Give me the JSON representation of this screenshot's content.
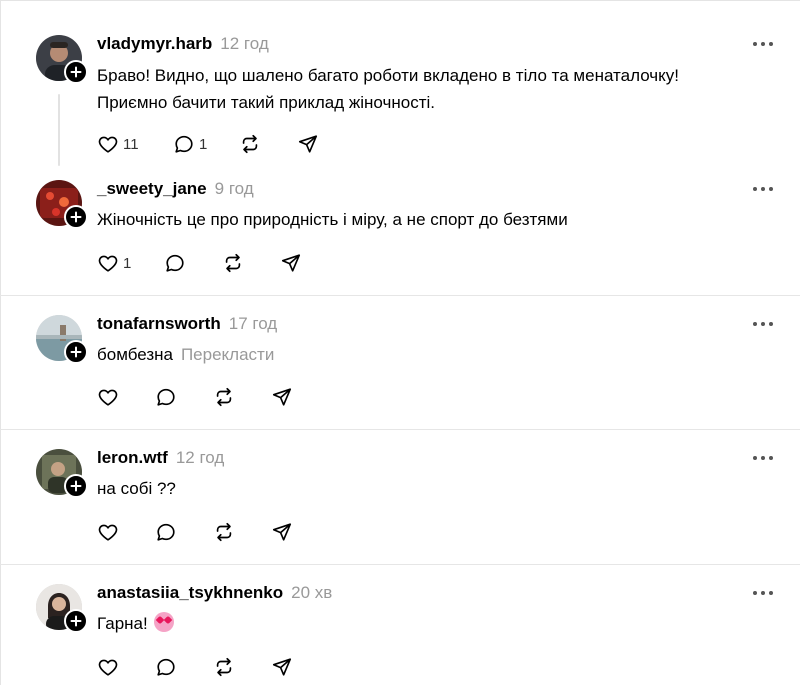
{
  "posts": [
    {
      "username": "vladymyr.harb",
      "time": "12 год",
      "text_lines": [
        "Браво! Видно, що шалено багато роботи вкладено в тіло та менаталочку!",
        "Приємно бачити такий приклад жіночності."
      ],
      "likes": "11",
      "replies": "1"
    },
    {
      "username": "_sweety_jane",
      "time": "9 год",
      "text_lines": [
        "Жіночність це про природність і міру, а не спорт до безтями"
      ],
      "likes": "1",
      "replies": ""
    },
    {
      "username": "tonafarnsworth",
      "time": "17 год",
      "text_lines": [
        "бомбезна"
      ],
      "translate": "Перекласти",
      "likes": "",
      "replies": ""
    },
    {
      "username": "leron.wtf",
      "time": "12 год",
      "text_lines": [
        "на собі ??"
      ],
      "likes": "",
      "replies": ""
    },
    {
      "username": "anastasiia_tsykhnenko",
      "time": "20 хв",
      "text_lines": [
        "Гарна!"
      ],
      "emoji": "smiling-face-with-heart-eyes",
      "likes": "",
      "replies": ""
    }
  ],
  "icons": {
    "like": "heart-icon",
    "reply": "comment-icon",
    "repost": "repost-icon",
    "share": "share-icon",
    "more": "more-icon",
    "follow": "plus-icon"
  },
  "colors": {
    "text": "#000000",
    "muted": "#999999",
    "divider": "#e6e6e6"
  }
}
